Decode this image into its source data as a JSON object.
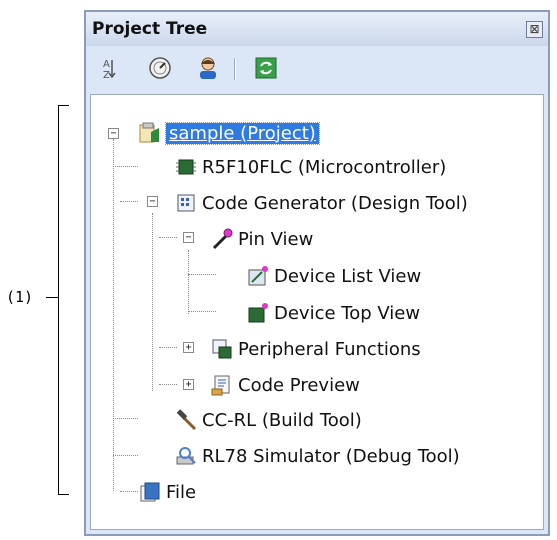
{
  "annotation": {
    "label": "(1)"
  },
  "panel": {
    "title": "Project Tree",
    "close_glyph": "⊠",
    "toolbar": [
      {
        "name": "sort-az-icon"
      },
      {
        "name": "property-icon"
      },
      {
        "name": "user-icon"
      },
      {
        "name": "refresh-icon"
      }
    ]
  },
  "tree": {
    "root": "sample (Project)",
    "items": [
      "R5F10FLC (Microcontroller)",
      "Code Generator (Design Tool)",
      "Pin View",
      "Device List View",
      "Device Top View",
      "Peripheral Functions",
      "Code Preview",
      "CC-RL (Build Tool)",
      "RL78 Simulator (Debug Tool)",
      "File"
    ],
    "expander_collapsed": "+",
    "expander_expanded": "−"
  },
  "colors": {
    "selection": "#2f7be3",
    "panel_bg": "#dbe6f6"
  }
}
